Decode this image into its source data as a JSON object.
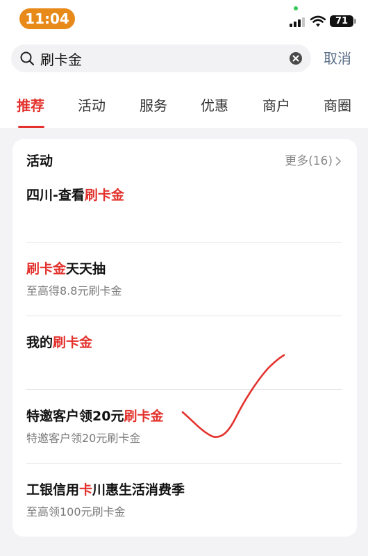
{
  "status_bar": {
    "time": "11:04",
    "battery": "71"
  },
  "search": {
    "query": "刷卡金",
    "cancel_label": "取消"
  },
  "tabs": [
    {
      "label": "推荐",
      "active": true
    },
    {
      "label": "活动",
      "active": false
    },
    {
      "label": "服务",
      "active": false
    },
    {
      "label": "优惠",
      "active": false
    },
    {
      "label": "商户",
      "active": false
    },
    {
      "label": "商圈",
      "active": false
    }
  ],
  "section": {
    "title": "活动",
    "more_label": "更多(16)"
  },
  "results": [
    {
      "title_before": "四川-查看",
      "highlight": "刷卡金",
      "title_after": "",
      "subtitle": ""
    },
    {
      "title_before": "",
      "highlight": "刷卡金",
      "title_after": "天天抽",
      "subtitle": "至高得8.8元刷卡金"
    },
    {
      "title_before": "我的",
      "highlight": "刷卡金",
      "title_after": "",
      "subtitle": ""
    },
    {
      "title_before": "特邀客户领20元",
      "highlight": "刷卡金",
      "title_after": "",
      "subtitle": "特邀客户领20元刷卡金"
    },
    {
      "title_before": "工银信用",
      "highlight": "卡",
      "title_after": "川惠生活消费季",
      "subtitle": "至高领100元刷卡金"
    }
  ],
  "colors": {
    "accent": "#e3322d",
    "time_pill": "#e88a1a",
    "link": "#5a6e86"
  },
  "icons": {
    "search": "search-icon",
    "clear": "clear-icon",
    "chevron": "chevron-right-icon",
    "annotation": "red-checkmark"
  }
}
